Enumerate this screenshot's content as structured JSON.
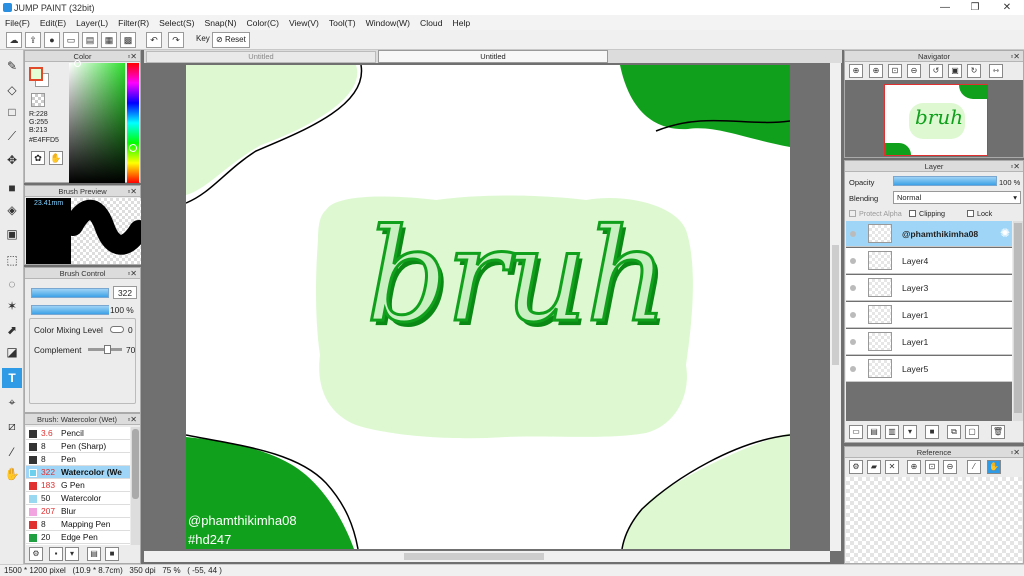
{
  "window": {
    "title": "JUMP PAINT (32bit)",
    "min": "—",
    "max": "❐",
    "close": "✕"
  },
  "menu": [
    "File(F)",
    "Edit(E)",
    "Layer(L)",
    "Filter(R)",
    "Select(S)",
    "Snap(N)",
    "Color(C)",
    "View(V)",
    "Tool(T)",
    "Window(W)",
    "Cloud",
    "Help"
  ],
  "toolbar": {
    "key_label": "Key",
    "reset_label": "Reset"
  },
  "tabs": [
    "Untitled",
    "Untitled"
  ],
  "color_panel": {
    "title": "Color",
    "r": "R:228",
    "g": "G:255",
    "b": "B:213",
    "hex": "#E4FFD5",
    "color": "#E4FFD5"
  },
  "brush_preview": {
    "title": "Brush Preview",
    "size": "23.41mm"
  },
  "brush_control": {
    "title": "Brush Control",
    "size": "322",
    "opacity": "100 %",
    "size_fill": 0.9,
    "opacity_fill": 1.0,
    "mix_label": "Color Mixing Level",
    "mix_value": "0",
    "complement_label": "Complement",
    "complement_value": "70"
  },
  "brush_list": {
    "title": "Brush: Watercolor (Wet)",
    "items": [
      {
        "num": "3.6",
        "label": "Pencil",
        "color": "#333333"
      },
      {
        "num": "8",
        "label": "Pen (Sharp)",
        "color": "#333333"
      },
      {
        "num": "8",
        "label": "Pen",
        "color": "#333333"
      },
      {
        "num": "322",
        "label": "Watercolor (We",
        "color": "#6fd0ee"
      },
      {
        "num": "183",
        "label": "G Pen",
        "color": "#e03030"
      },
      {
        "num": "50",
        "label": "Watercolor",
        "color": "#9ad8f2"
      },
      {
        "num": "207",
        "label": "Blur",
        "color": "#f2a4e0"
      },
      {
        "num": "8",
        "label": "Mapping Pen",
        "color": "#e03030"
      },
      {
        "num": "20",
        "label": "Edge Pen",
        "color": "#20a040"
      }
    ]
  },
  "canvas": {
    "bg": "#ffffff",
    "accent": "#11a01c",
    "pale": "#def9d2",
    "word": "bruh",
    "watermark1": "@phamthikimha08",
    "watermark2": "#hd247"
  },
  "navigator": {
    "title": "Navigator",
    "thumb_text": "bruh"
  },
  "layer_panel": {
    "title": "Layer",
    "opacity_label": "Opacity",
    "opacity_value": "100 %",
    "blending_label": "Blending",
    "blending_value": "Normal",
    "protect_alpha": "Protect Alpha",
    "clipping": "Clipping",
    "lock": "Lock",
    "layers": [
      "@phamthikimha08",
      "Layer4",
      "Layer3",
      "Layer1",
      "Layer1",
      "Layer5"
    ]
  },
  "reference": {
    "title": "Reference"
  },
  "status": "1500 * 1200 pixel   (10.9 * 8.7cm)   350 dpi   75 %   ( -55, 44 )"
}
